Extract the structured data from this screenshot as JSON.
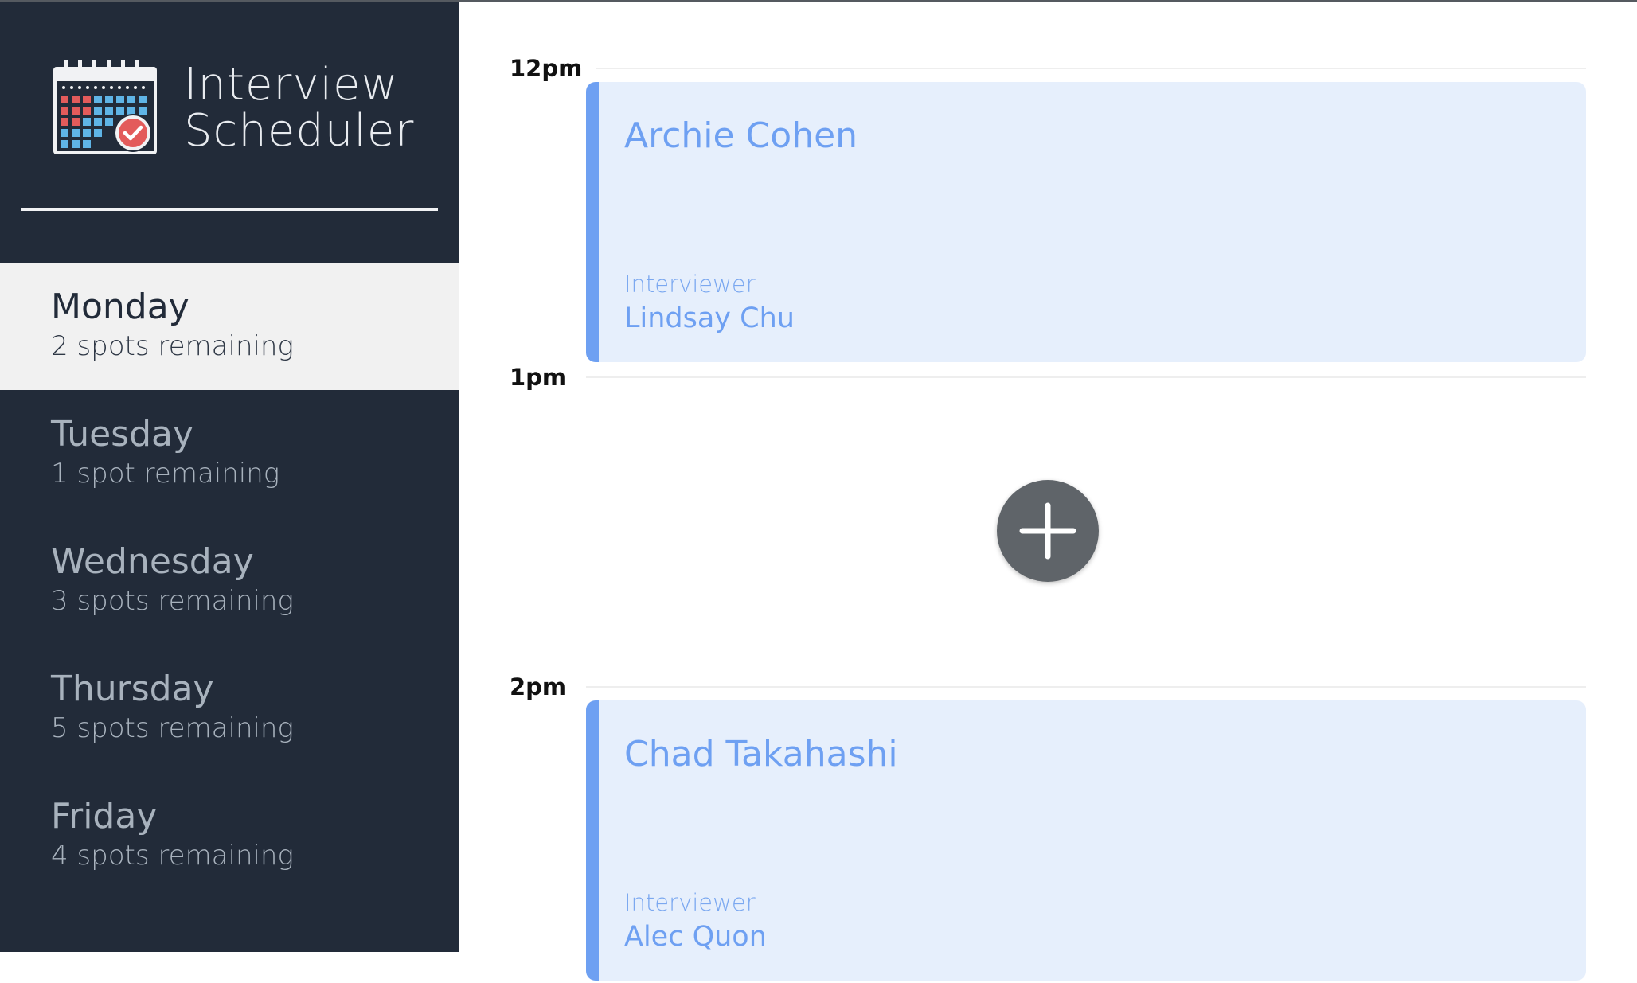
{
  "app": {
    "title_line1": "Interview",
    "title_line2": "Scheduler",
    "logo_icon": "calendar-check-icon"
  },
  "colors": {
    "sidebar_bg": "#222b39",
    "selected_day_bg": "#f1f1f1",
    "appointment_bg": "#e6effc",
    "appointment_accent": "#6ea0f2",
    "add_button_bg": "#5f6469"
  },
  "days": [
    {
      "name": "Monday",
      "spots": "2 spots remaining",
      "selected": true
    },
    {
      "name": "Tuesday",
      "spots": "1 spot remaining",
      "selected": false
    },
    {
      "name": "Wednesday",
      "spots": "3 spots remaining",
      "selected": false
    },
    {
      "name": "Thursday",
      "spots": "5 spots remaining",
      "selected": false
    },
    {
      "name": "Friday",
      "spots": "4 spots remaining",
      "selected": false
    }
  ],
  "schedule": {
    "slots": [
      {
        "time": "12pm",
        "appointment": {
          "student": "Archie Cohen",
          "interviewer_label": "Interviewer",
          "interviewer": "Lindsay Chu"
        }
      },
      {
        "time": "1pm",
        "empty": true,
        "add_icon": "plus-icon"
      },
      {
        "time": "2pm",
        "appointment": {
          "student": "Chad Takahashi",
          "interviewer_label": "Interviewer",
          "interviewer": "Alec Quon"
        }
      }
    ]
  }
}
